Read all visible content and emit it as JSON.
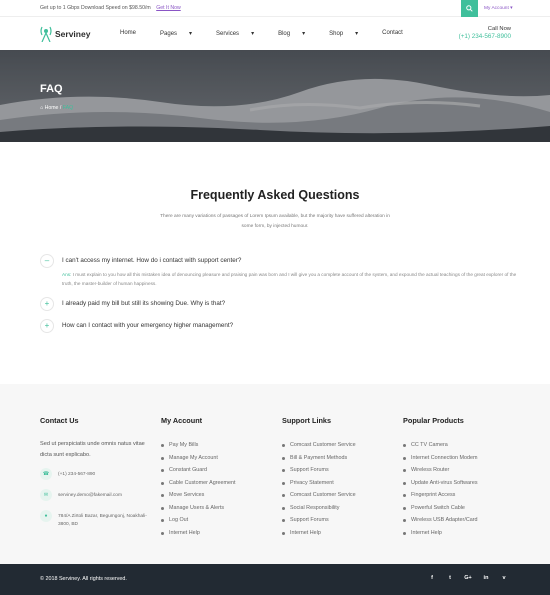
{
  "topbar": {
    "promo_text": "Get up to 1 Gbps Download Speed on $98.50/m",
    "promo_link": "Get It Now",
    "account_label": "My Account ▾",
    "search_icon": "search-icon"
  },
  "nav": {
    "brand": "Serviney",
    "items": [
      {
        "label": "Home"
      },
      {
        "label": "Pages",
        "caret": "▾"
      },
      {
        "label": "Services",
        "caret": "▾"
      },
      {
        "label": "Blog",
        "caret": "▾"
      },
      {
        "label": "Shop",
        "caret": "▾"
      },
      {
        "label": "Contact"
      }
    ],
    "call_label": "Call Now",
    "call_phone": "(+1) 234-567-8900"
  },
  "hero": {
    "title": "FAQ",
    "breadcrumb_home": "Home",
    "breadcrumb_sep": "/",
    "breadcrumb_current": "FAQ"
  },
  "faq": {
    "title": "Frequently Asked Questions",
    "description": "There are many variations of passages of Lorem Ipsum available, but the majority have suffered alteration in some form, by injected humour.",
    "items": [
      {
        "toggle": "–",
        "question": "I can't access my internet. How do i contact with support center?",
        "answer_label": "Ans:",
        "answer": "I must explain to you how all this mistaken idea of denouncing pleasure and praising pain was born and I will give you a complete account of the system, and expound the actual teachings of the great explorer of the truth, the master-builder of human happiness."
      },
      {
        "toggle": "+",
        "question": "I already paid my bill but still its showing Due. Why is that?"
      },
      {
        "toggle": "+",
        "question": "How can I contact with your emergency higher management?"
      }
    ]
  },
  "footer": {
    "contact": {
      "title": "Contact Us",
      "about": "Sed ut perspiciatis unde omnis natus vitae dicta sunt explicabo.",
      "phone": "(+1) 234-567-890",
      "email": "serviney.demo@fakemail.com",
      "address": "784/A Zirtoli Bazar, Begumgonj, Noakhali-3800, BD"
    },
    "my_account": {
      "title": "My Account",
      "items": [
        "Pay My Bills",
        "Manage My Account",
        "Constant Guard",
        "Cable Customer Agreement",
        "Move Services",
        "Manage Users & Alerts",
        "Log Out",
        "Internet Help"
      ]
    },
    "support_links": {
      "title": "Support Links",
      "items": [
        "Comcast Customer Service",
        "Bill & Payment Methods",
        "Support Forums",
        "Privacy Statement",
        "Comcast Customer Service",
        "Social Responsibility",
        "Support Forums",
        "Internet Help"
      ]
    },
    "popular_products": {
      "title": "Popular Products",
      "items": [
        "CC TV Camera",
        "Internet Connection Modem",
        "Wireless Router",
        "Update Anti-virus Softwares",
        "Fingerprint Access",
        "Powerful Switch Cable",
        "Wireless USB Adapter/Card",
        "Internet Help"
      ]
    }
  },
  "bottom": {
    "copyright": "© 2018 Serviney. All rights reserved.",
    "socials": [
      {
        "icon": "facebook-icon",
        "glyph": "f"
      },
      {
        "icon": "twitter-icon",
        "glyph": "t"
      },
      {
        "icon": "google-plus-icon",
        "glyph": "G+"
      },
      {
        "icon": "linkedin-icon",
        "glyph": "in"
      },
      {
        "icon": "vimeo-icon",
        "glyph": "v"
      }
    ]
  },
  "colors": {
    "accent_green": "#3fbf9b",
    "accent_purple": "#8a55c5",
    "footer_dark": "#222a33"
  }
}
